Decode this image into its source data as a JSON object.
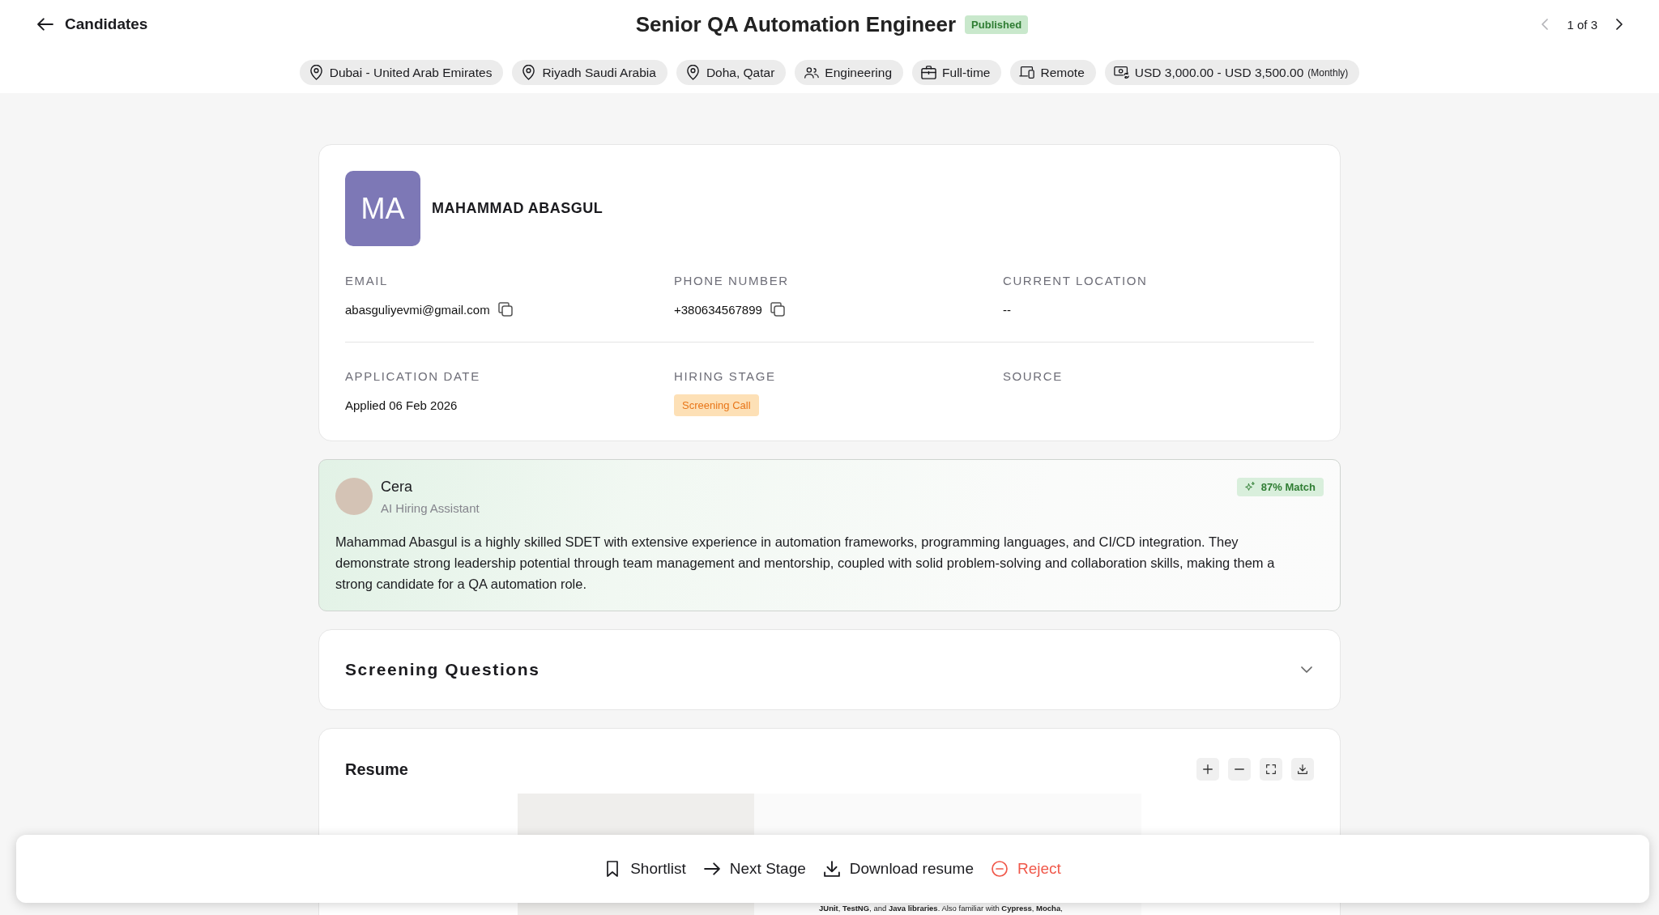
{
  "header": {
    "back_label": "Candidates",
    "title": "Senior QA Automation Engineer",
    "status": "Published",
    "pagination": {
      "label": "1 of 3",
      "prev_disabled": true,
      "next_disabled": false
    }
  },
  "chips": [
    {
      "kind": "location",
      "label": "Dubai - United Arab Emirates"
    },
    {
      "kind": "location",
      "label": "Riyadh Saudi Arabia"
    },
    {
      "kind": "location",
      "label": "Doha, Qatar"
    },
    {
      "kind": "department",
      "label": "Engineering"
    },
    {
      "kind": "employment",
      "label": "Full-time"
    },
    {
      "kind": "workplace",
      "label": "Remote"
    },
    {
      "kind": "salary",
      "label": "USD 3,000.00 - USD 3,500.00",
      "note": "(Monthly)"
    }
  ],
  "candidate": {
    "initials": "MA",
    "name": "MAHAMMAD ABASGUL",
    "rows": [
      {
        "fields": [
          {
            "kind": "copyable",
            "label": "EMAIL",
            "value": "abasguliyevmi@gmail.com"
          },
          {
            "kind": "copyable",
            "label": "PHONE NUMBER",
            "value": "+380634567899"
          },
          {
            "kind": "text",
            "label": "CURRENT LOCATION",
            "value": "--"
          }
        ]
      },
      {
        "fields": [
          {
            "kind": "text",
            "label": "APPLICATION DATE",
            "value": "Applied 06 Feb 2026"
          },
          {
            "kind": "badge",
            "label": "HIRING STAGE",
            "value": "Screening Call"
          },
          {
            "kind": "empty",
            "label": "SOURCE"
          }
        ]
      }
    ]
  },
  "ai_summary": {
    "name": "Cera",
    "role": "AI Hiring Assistant",
    "match": "87% Match",
    "text": "Mahammad Abasgul is a highly skilled SDET with extensive experience in automation frameworks, programming languages, and CI/CD integration. They demonstrate strong leadership potential through team management and mentorship, coupled with solid problem-solving and collaboration skills, making them a strong candidate for a QA automation role."
  },
  "sections": [
    {
      "title": "Screening Questions",
      "expanded": false
    }
  ],
  "resume": {
    "title": "Resume",
    "toolbar": [
      {
        "kind": "zoom-in"
      },
      {
        "kind": "zoom-out"
      },
      {
        "kind": "fullscreen"
      },
      {
        "kind": "download"
      }
    ],
    "document_text": "**JUnit**, **TestNG**, and **Java libraries**. Also familiar with **Cypress**, **Mocha**,"
  },
  "actions": [
    {
      "kind": "shortlist",
      "label": "Shortlist"
    },
    {
      "kind": "next",
      "label": "Next Stage"
    },
    {
      "kind": "download",
      "label": "Download resume"
    },
    {
      "kind": "reject",
      "label": "Reject"
    }
  ]
}
